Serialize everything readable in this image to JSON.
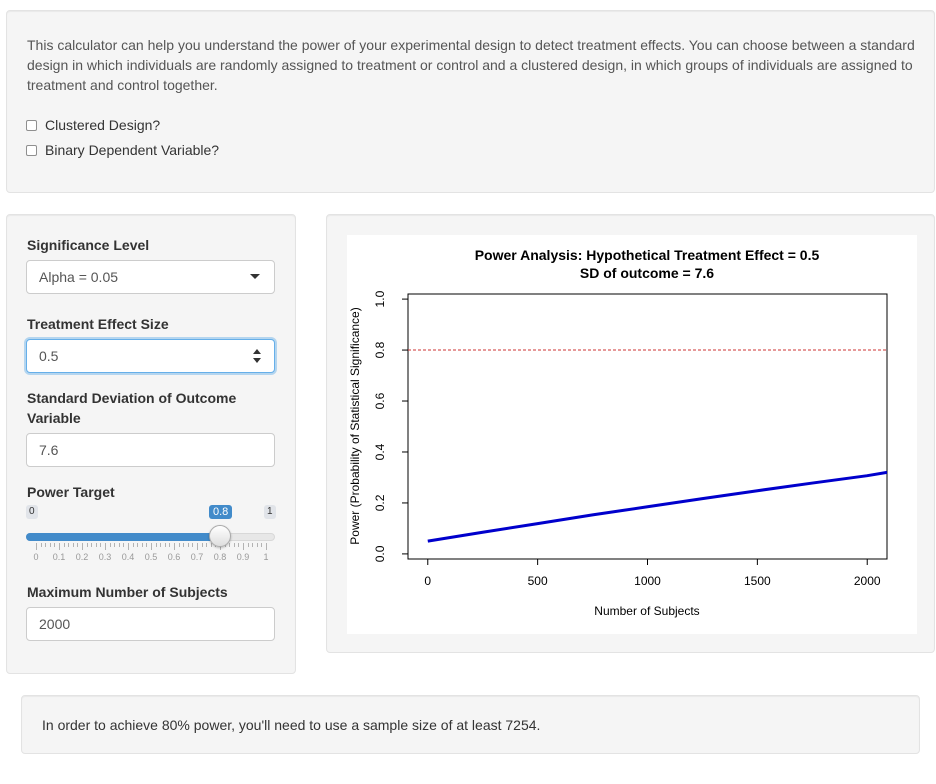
{
  "intro": {
    "description": "This calculator can help you understand the power of your experimental design to detect treatment effects. You can choose between a standard design in which individuals are randomly assigned to treatment or control and a clustered design, in which groups of individuals are assigned to treatment and control together.",
    "clustered_label": "Clustered Design?",
    "binary_label": "Binary Dependent Variable?"
  },
  "sidebar": {
    "significance_label": "Significance Level",
    "significance_value": "Alpha = 0.05",
    "effect_label": "Treatment Effect Size",
    "effect_value": "0.5",
    "sd_label": "Standard Deviation of Outcome Variable",
    "sd_value": "7.6",
    "power_label": "Power Target",
    "power_min_label": "0",
    "power_max_label": "1",
    "power_value_label": "0.8",
    "power_value": 0.8,
    "power_grid": [
      "0",
      "0.1",
      "0.2",
      "0.3",
      "0.4",
      "0.5",
      "0.6",
      "0.7",
      "0.8",
      "0.9",
      "1"
    ],
    "max_subjects_label": "Maximum Number of Subjects",
    "max_subjects_value": "2000"
  },
  "chart_data": {
    "type": "line",
    "title": "Power Analysis: Hypothetical Treatment Effect = 0.5",
    "subtitle": "SD of outcome = 7.6",
    "xlabel": "Number of Subjects",
    "ylabel": "Power (Probability of Statistical Significance)",
    "xlim": [
      -90,
      2090
    ],
    "ylim": [
      -0.02,
      1.02
    ],
    "xticks": [
      0,
      500,
      1000,
      1500,
      2000
    ],
    "yticks": [
      0.0,
      0.2,
      0.4,
      0.6,
      0.8,
      1.0
    ],
    "xtick_labels": [
      "0",
      "500",
      "1000",
      "1500",
      "2000"
    ],
    "ytick_labels": [
      "0.0",
      "0.2",
      "0.4",
      "0.6",
      "0.8",
      "1.0"
    ],
    "reference_line": {
      "y": 0.8,
      "color": "#cc3333",
      "style": "dashed"
    },
    "series": [
      {
        "color": "#0000cc",
        "x": [
          0,
          250,
          500,
          750,
          1000,
          1250,
          1500,
          1750,
          2000,
          2090
        ],
        "y": [
          0.05,
          0.085,
          0.119,
          0.153,
          0.185,
          0.217,
          0.248,
          0.278,
          0.307,
          0.32
        ]
      }
    ],
    "grid": false
  },
  "footer": {
    "result_text": "In order to achieve 80% power, you'll need to use a sample size of at least 7254."
  }
}
